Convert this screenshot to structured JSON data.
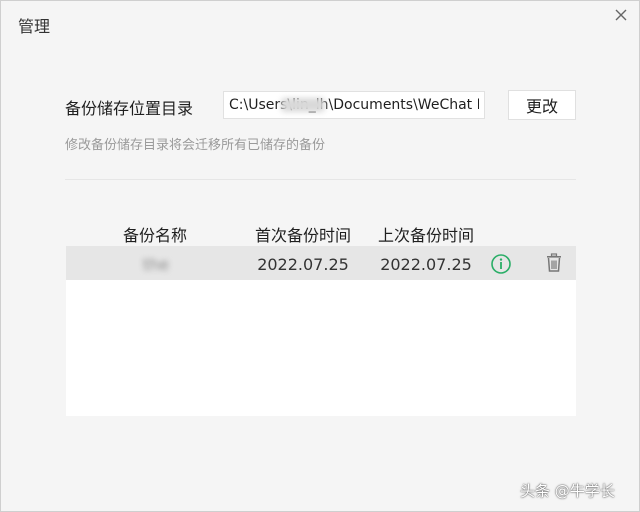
{
  "window": {
    "title": "管理",
    "close_icon": "close-icon"
  },
  "backup_dir": {
    "label": "备份储存位置目录",
    "path_value": "C:\\Users\\lin_lh\\Documents\\WeChat Fil",
    "change_label": "更改",
    "hint": "修改备份储存目录将会迁移所有已储存的备份"
  },
  "table": {
    "headers": {
      "name": "备份名称",
      "first_time": "首次备份时间",
      "last_time": "上次备份时间"
    },
    "rows": [
      {
        "name": "the",
        "first_time": "2022.07.25",
        "last_time": "2022.07.25",
        "info_icon": "info-icon",
        "delete_icon": "trash-icon"
      }
    ]
  },
  "colors": {
    "window_bg": "#f5f5f5",
    "row_bg": "#e6e6e6",
    "info_green": "#2aae67",
    "hint_gray": "#9a9a9a"
  },
  "watermark": "头条 @牛学长"
}
